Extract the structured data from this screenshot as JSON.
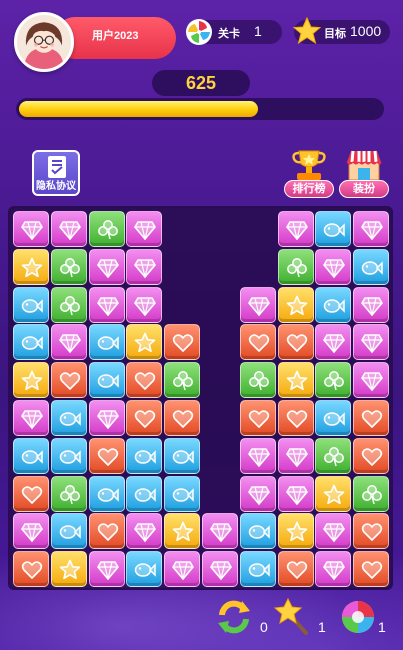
{
  "header": {
    "username": "用户2023",
    "level_label": "关卡",
    "level_value": "1",
    "target_label": "目标",
    "target_value": "1000"
  },
  "score": "625",
  "progress_fraction": 0.66,
  "buttons": {
    "privacy_label": "隐私协议",
    "rank_label": "排行榜",
    "shop_label": "装扮"
  },
  "colors": {
    "pink": "#e85ad8",
    "green": "#58c94a",
    "yellow": "#f7c025",
    "blue": "#3bb4ee",
    "red": "#f0603a"
  },
  "board": {
    "cols": 10,
    "rows": 10,
    "grid": [
      [
        "pink",
        "pink",
        "green",
        "pink",
        "",
        "",
        "",
        "pink",
        "blue",
        "pink"
      ],
      [
        "yellow",
        "green",
        "pink",
        "pink",
        "",
        "",
        "",
        "green",
        "pink",
        "blue"
      ],
      [
        "blue",
        "green",
        "pink",
        "pink",
        "",
        "",
        "pink",
        "yellow",
        "blue",
        "pink"
      ],
      [
        "blue",
        "pink",
        "blue",
        "yellow",
        "red",
        "",
        "red",
        "red",
        "pink",
        "pink"
      ],
      [
        "yellow",
        "red",
        "blue",
        "red",
        "green",
        "",
        "green",
        "yellow",
        "green",
        "pink"
      ],
      [
        "pink",
        "blue",
        "pink",
        "red",
        "red",
        "",
        "red",
        "red",
        "blue",
        "red"
      ],
      [
        "blue",
        "blue",
        "red",
        "blue",
        "blue",
        "",
        "pink",
        "pink",
        "green",
        "red"
      ],
      [
        "red",
        "green",
        "blue",
        "blue",
        "blue",
        "",
        "pink",
        "pink",
        "yellow",
        "green"
      ],
      [
        "pink",
        "blue",
        "red",
        "pink",
        "yellow",
        "pink",
        "blue",
        "yellow",
        "pink",
        "red"
      ],
      [
        "red",
        "yellow",
        "pink",
        "blue",
        "pink",
        "pink",
        "blue",
        "red",
        "pink",
        "red"
      ]
    ]
  },
  "powerups": [
    {
      "icon": "refresh-icon",
      "count": "0"
    },
    {
      "icon": "magic-wand-icon",
      "count": "1"
    },
    {
      "icon": "rainbow-ball-icon",
      "count": "1"
    }
  ]
}
